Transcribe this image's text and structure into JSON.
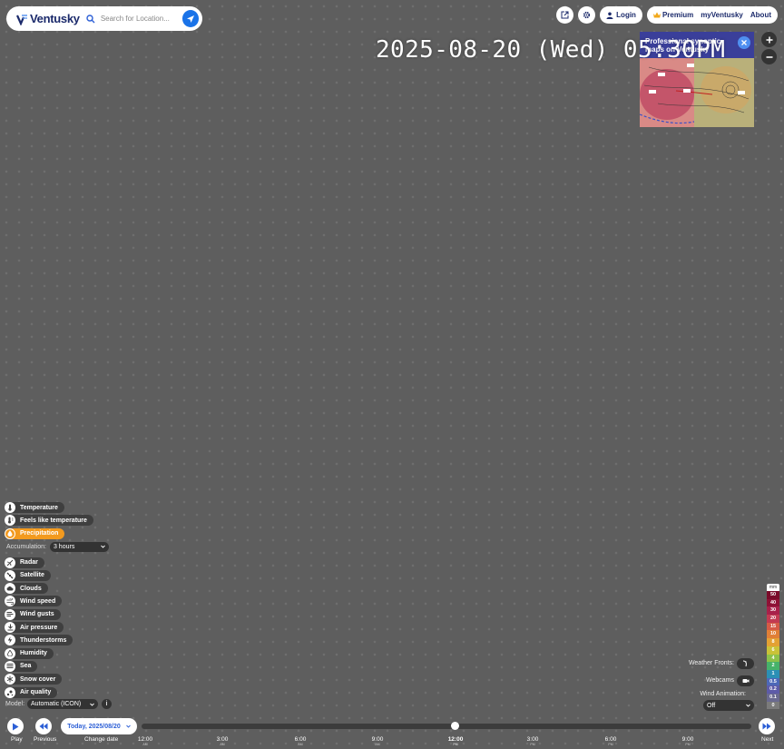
{
  "header": {
    "logo_text": "Ventusky",
    "search_placeholder": "Search for Location...",
    "login_label": "Login",
    "premium_label": "Premium",
    "myventusky_label": "myVentusky",
    "about_label": "About"
  },
  "datetime": "2025-08-20 (Wed) 05:30PM",
  "promo": {
    "title": "Professional synoptic maps on Ventusky"
  },
  "layers": {
    "items": [
      {
        "label": "Temperature",
        "icon": "thermometer-icon"
      },
      {
        "label": "Feels like temperature",
        "icon": "feels-like-icon"
      },
      {
        "label": "Precipitation",
        "icon": "droplet-icon",
        "active": true
      }
    ],
    "accumulation_label": "Accumulation:",
    "accumulation_value": "3 hours",
    "more": [
      {
        "label": "Radar",
        "icon": "radar-icon"
      },
      {
        "label": "Satellite",
        "icon": "satellite-icon"
      },
      {
        "label": "Clouds",
        "icon": "cloud-icon"
      },
      {
        "label": "Wind speed",
        "icon": "wind-icon"
      },
      {
        "label": "Wind gusts",
        "icon": "wind-gust-icon"
      },
      {
        "label": "Air pressure",
        "icon": "pressure-icon"
      },
      {
        "label": "Thunderstorms",
        "icon": "lightning-icon"
      },
      {
        "label": "Humidity",
        "icon": "humidity-icon"
      },
      {
        "label": "Sea",
        "icon": "waves-icon"
      },
      {
        "label": "Snow cover",
        "icon": "snowflake-icon"
      },
      {
        "label": "Air quality",
        "icon": "air-quality-icon"
      }
    ]
  },
  "model": {
    "label": "Model:",
    "value": "Automatic (ICON)",
    "info": "i"
  },
  "right_panel": {
    "weather_fronts_label": "Weather Fronts:",
    "webcams_label": "Webcams",
    "wind_animation_label": "Wind Animation:",
    "wind_animation_value": "Off"
  },
  "legend": {
    "unit": "mm",
    "levels": [
      {
        "v": "50",
        "c": "#7a0b2a"
      },
      {
        "v": "40",
        "c": "#8e1236"
      },
      {
        "v": "30",
        "c": "#a8214a"
      },
      {
        "v": "20",
        "c": "#c23a52"
      },
      {
        "v": "15",
        "c": "#d65a46"
      },
      {
        "v": "10",
        "c": "#e07f36"
      },
      {
        "v": "8",
        "c": "#e3a133"
      },
      {
        "v": "6",
        "c": "#c9c238"
      },
      {
        "v": "4",
        "c": "#8cc14a"
      },
      {
        "v": "2",
        "c": "#46b26a"
      },
      {
        "v": "1",
        "c": "#2b8fb5"
      },
      {
        "v": "0.5",
        "c": "#4d68b8"
      },
      {
        "v": "0.2",
        "c": "#5d5ba8"
      },
      {
        "v": "0.1",
        "c": "#6a6a90"
      },
      {
        "v": "0",
        "c": "#7b7b7b"
      }
    ]
  },
  "timeline": {
    "play_label": "Play",
    "previous_label": "Previous",
    "change_date_label": "Change date",
    "next_label": "Next",
    "date_value": "Today, 2025/08/20",
    "ticks": [
      {
        "t": "12:00",
        "p": "AM"
      },
      {
        "t": "3:00",
        "p": "AM"
      },
      {
        "t": "6:00",
        "p": "AM"
      },
      {
        "t": "9:00",
        "p": "AM"
      },
      {
        "t": "12:00",
        "p": "PM",
        "current": true
      },
      {
        "t": "3:00",
        "p": "PM"
      },
      {
        "t": "6:00",
        "p": "PM"
      },
      {
        "t": "9:00",
        "p": "PM"
      }
    ]
  }
}
